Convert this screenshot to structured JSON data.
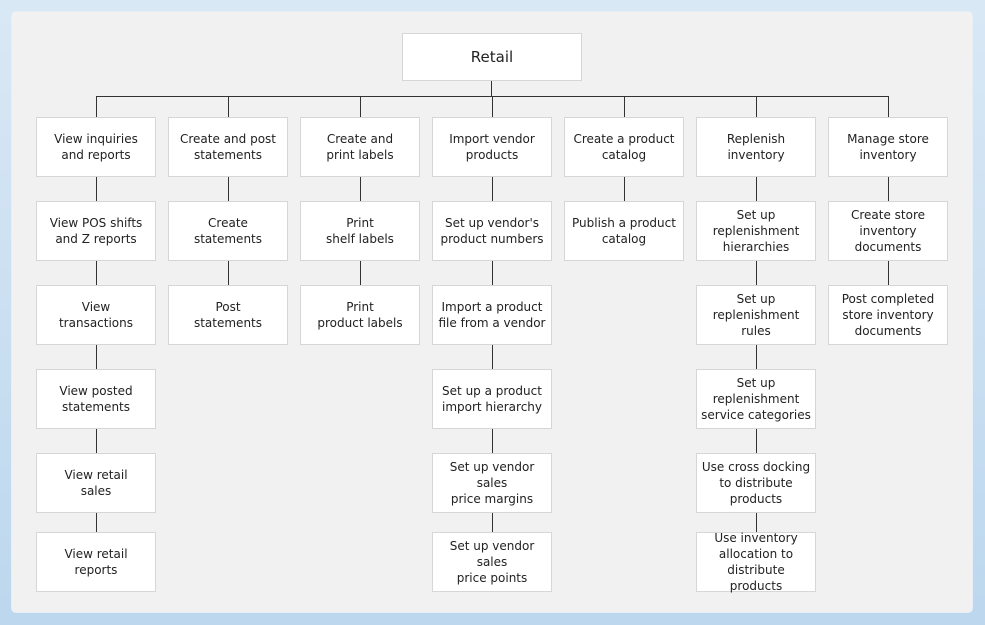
{
  "diagram": {
    "root": "Retail",
    "columns": [
      {
        "title": "View inquiries\nand reports",
        "children": [
          "View POS shifts\nand Z reports",
          "View\ntransactions",
          "View posted\nstatements",
          "View retail\nsales",
          "View retail\nreports"
        ]
      },
      {
        "title": "Create and post\nstatements",
        "children": [
          "Create\nstatements",
          "Post\nstatements"
        ]
      },
      {
        "title": "Create and\nprint labels",
        "children": [
          "Print\nshelf labels",
          "Print\nproduct labels"
        ]
      },
      {
        "title": "Import vendor\nproducts",
        "children": [
          "Set up vendor's\nproduct numbers",
          "Import a product\nfile from a vendor",
          "Set up a product\nimport hierarchy",
          "Set up vendor sales\nprice margins",
          "Set up vendor sales\nprice points"
        ]
      },
      {
        "title": "Create a product\ncatalog",
        "children": [
          "Publish a product\ncatalog"
        ]
      },
      {
        "title": "Replenish\ninventory",
        "children": [
          "Set up\nreplenishment\nhierarchies",
          "Set up\nreplenishment\nrules",
          "Set up\nreplenishment\nservice categories",
          "Use cross docking\nto distribute\nproducts",
          "Use inventory\nallocation to\ndistribute products"
        ]
      },
      {
        "title": "Manage store\ninventory",
        "children": [
          "Create store\ninventory\ndocuments",
          "Post completed\nstore inventory\ndocuments"
        ]
      }
    ]
  }
}
